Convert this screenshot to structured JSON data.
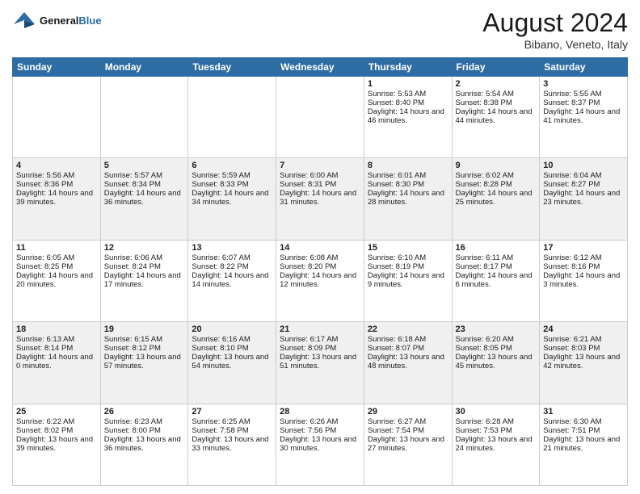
{
  "header": {
    "logo_line1": "General",
    "logo_line2": "Blue",
    "month_title": "August 2024",
    "location": "Bibano, Veneto, Italy"
  },
  "days_of_week": [
    "Sunday",
    "Monday",
    "Tuesday",
    "Wednesday",
    "Thursday",
    "Friday",
    "Saturday"
  ],
  "weeks": [
    [
      {
        "day": "",
        "sunrise": "",
        "sunset": "",
        "daylight": ""
      },
      {
        "day": "",
        "sunrise": "",
        "sunset": "",
        "daylight": ""
      },
      {
        "day": "",
        "sunrise": "",
        "sunset": "",
        "daylight": ""
      },
      {
        "day": "",
        "sunrise": "",
        "sunset": "",
        "daylight": ""
      },
      {
        "day": "1",
        "sunrise": "Sunrise: 5:53 AM",
        "sunset": "Sunset: 8:40 PM",
        "daylight": "Daylight: 14 hours and 46 minutes."
      },
      {
        "day": "2",
        "sunrise": "Sunrise: 5:54 AM",
        "sunset": "Sunset: 8:38 PM",
        "daylight": "Daylight: 14 hours and 44 minutes."
      },
      {
        "day": "3",
        "sunrise": "Sunrise: 5:55 AM",
        "sunset": "Sunset: 8:37 PM",
        "daylight": "Daylight: 14 hours and 41 minutes."
      }
    ],
    [
      {
        "day": "4",
        "sunrise": "Sunrise: 5:56 AM",
        "sunset": "Sunset: 8:36 PM",
        "daylight": "Daylight: 14 hours and 39 minutes."
      },
      {
        "day": "5",
        "sunrise": "Sunrise: 5:57 AM",
        "sunset": "Sunset: 8:34 PM",
        "daylight": "Daylight: 14 hours and 36 minutes."
      },
      {
        "day": "6",
        "sunrise": "Sunrise: 5:59 AM",
        "sunset": "Sunset: 8:33 PM",
        "daylight": "Daylight: 14 hours and 34 minutes."
      },
      {
        "day": "7",
        "sunrise": "Sunrise: 6:00 AM",
        "sunset": "Sunset: 8:31 PM",
        "daylight": "Daylight: 14 hours and 31 minutes."
      },
      {
        "day": "8",
        "sunrise": "Sunrise: 6:01 AM",
        "sunset": "Sunset: 8:30 PM",
        "daylight": "Daylight: 14 hours and 28 minutes."
      },
      {
        "day": "9",
        "sunrise": "Sunrise: 6:02 AM",
        "sunset": "Sunset: 8:28 PM",
        "daylight": "Daylight: 14 hours and 25 minutes."
      },
      {
        "day": "10",
        "sunrise": "Sunrise: 6:04 AM",
        "sunset": "Sunset: 8:27 PM",
        "daylight": "Daylight: 14 hours and 23 minutes."
      }
    ],
    [
      {
        "day": "11",
        "sunrise": "Sunrise: 6:05 AM",
        "sunset": "Sunset: 8:25 PM",
        "daylight": "Daylight: 14 hours and 20 minutes."
      },
      {
        "day": "12",
        "sunrise": "Sunrise: 6:06 AM",
        "sunset": "Sunset: 8:24 PM",
        "daylight": "Daylight: 14 hours and 17 minutes."
      },
      {
        "day": "13",
        "sunrise": "Sunrise: 6:07 AM",
        "sunset": "Sunset: 8:22 PM",
        "daylight": "Daylight: 14 hours and 14 minutes."
      },
      {
        "day": "14",
        "sunrise": "Sunrise: 6:08 AM",
        "sunset": "Sunset: 8:20 PM",
        "daylight": "Daylight: 14 hours and 12 minutes."
      },
      {
        "day": "15",
        "sunrise": "Sunrise: 6:10 AM",
        "sunset": "Sunset: 8:19 PM",
        "daylight": "Daylight: 14 hours and 9 minutes."
      },
      {
        "day": "16",
        "sunrise": "Sunrise: 6:11 AM",
        "sunset": "Sunset: 8:17 PM",
        "daylight": "Daylight: 14 hours and 6 minutes."
      },
      {
        "day": "17",
        "sunrise": "Sunrise: 6:12 AM",
        "sunset": "Sunset: 8:16 PM",
        "daylight": "Daylight: 14 hours and 3 minutes."
      }
    ],
    [
      {
        "day": "18",
        "sunrise": "Sunrise: 6:13 AM",
        "sunset": "Sunset: 8:14 PM",
        "daylight": "Daylight: 14 hours and 0 minutes."
      },
      {
        "day": "19",
        "sunrise": "Sunrise: 6:15 AM",
        "sunset": "Sunset: 8:12 PM",
        "daylight": "Daylight: 13 hours and 57 minutes."
      },
      {
        "day": "20",
        "sunrise": "Sunrise: 6:16 AM",
        "sunset": "Sunset: 8:10 PM",
        "daylight": "Daylight: 13 hours and 54 minutes."
      },
      {
        "day": "21",
        "sunrise": "Sunrise: 6:17 AM",
        "sunset": "Sunset: 8:09 PM",
        "daylight": "Daylight: 13 hours and 51 minutes."
      },
      {
        "day": "22",
        "sunrise": "Sunrise: 6:18 AM",
        "sunset": "Sunset: 8:07 PM",
        "daylight": "Daylight: 13 hours and 48 minutes."
      },
      {
        "day": "23",
        "sunrise": "Sunrise: 6:20 AM",
        "sunset": "Sunset: 8:05 PM",
        "daylight": "Daylight: 13 hours and 45 minutes."
      },
      {
        "day": "24",
        "sunrise": "Sunrise: 6:21 AM",
        "sunset": "Sunset: 8:03 PM",
        "daylight": "Daylight: 13 hours and 42 minutes."
      }
    ],
    [
      {
        "day": "25",
        "sunrise": "Sunrise: 6:22 AM",
        "sunset": "Sunset: 8:02 PM",
        "daylight": "Daylight: 13 hours and 39 minutes."
      },
      {
        "day": "26",
        "sunrise": "Sunrise: 6:23 AM",
        "sunset": "Sunset: 8:00 PM",
        "daylight": "Daylight: 13 hours and 36 minutes."
      },
      {
        "day": "27",
        "sunrise": "Sunrise: 6:25 AM",
        "sunset": "Sunset: 7:58 PM",
        "daylight": "Daylight: 13 hours and 33 minutes."
      },
      {
        "day": "28",
        "sunrise": "Sunrise: 6:26 AM",
        "sunset": "Sunset: 7:56 PM",
        "daylight": "Daylight: 13 hours and 30 minutes."
      },
      {
        "day": "29",
        "sunrise": "Sunrise: 6:27 AM",
        "sunset": "Sunset: 7:54 PM",
        "daylight": "Daylight: 13 hours and 27 minutes."
      },
      {
        "day": "30",
        "sunrise": "Sunrise: 6:28 AM",
        "sunset": "Sunset: 7:53 PM",
        "daylight": "Daylight: 13 hours and 24 minutes."
      },
      {
        "day": "31",
        "sunrise": "Sunrise: 6:30 AM",
        "sunset": "Sunset: 7:51 PM",
        "daylight": "Daylight: 13 hours and 21 minutes."
      }
    ]
  ]
}
